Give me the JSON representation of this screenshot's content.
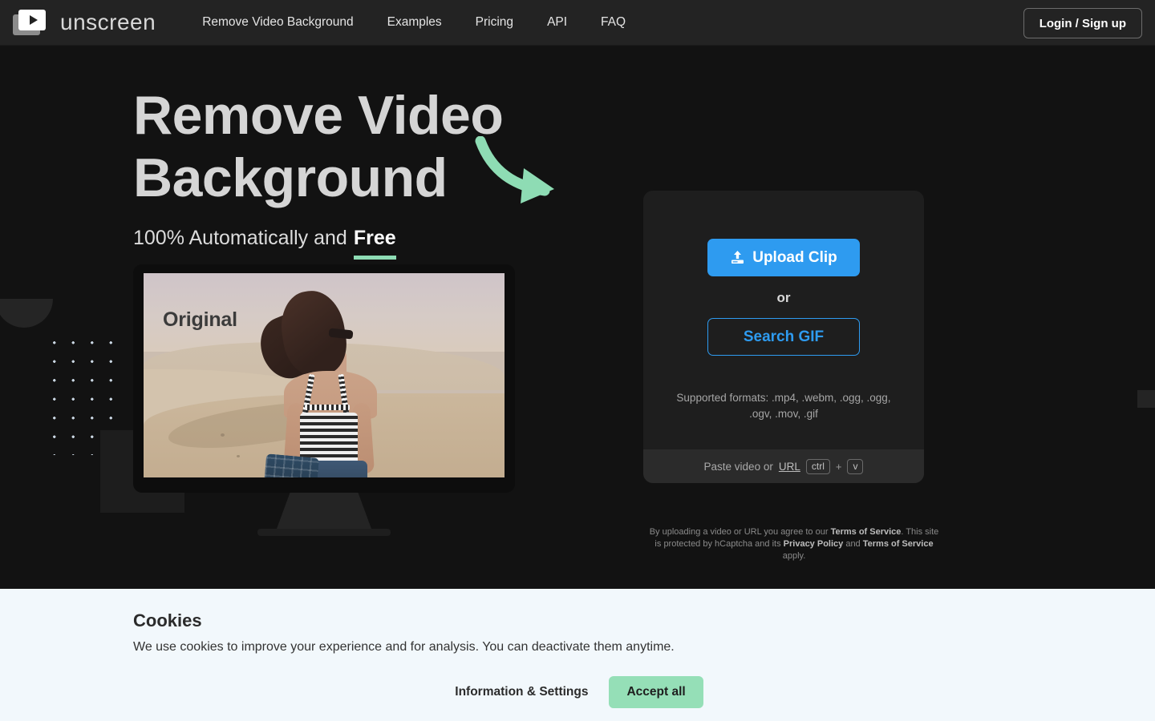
{
  "header": {
    "logo_text": "unscreen",
    "logo_icon": "video-play-cards-icon",
    "nav": [
      {
        "label": "Remove Video Background"
      },
      {
        "label": "Examples"
      },
      {
        "label": "Pricing"
      },
      {
        "label": "API"
      },
      {
        "label": "FAQ"
      }
    ],
    "login_label": "Login / Sign up",
    "bg_color": "#232323"
  },
  "hero": {
    "title": "Remove Video Background",
    "subtitle_prefix": "100% Automatically and",
    "subtitle_highlight": "Free",
    "highlight_underline_color": "#8edcb4",
    "arrow_icon": "curved-arrow-icon",
    "arrow_color": "#8edcb4"
  },
  "preview": {
    "label": "Original",
    "alt": "woman in striped top standing in desert dunes"
  },
  "upload": {
    "upload_label": "Upload Clip",
    "upload_icon": "upload-icon",
    "upload_color": "#2e9bf0",
    "or_label": "or",
    "gif_label": "Search GIF",
    "formats": "Supported formats: .mp4, .webm, .ogg, .ogg, .ogv, .mov, .gif",
    "paste_prefix": "Paste video or",
    "paste_link": "URL",
    "key_ctrl": "ctrl",
    "key_plus": "+",
    "key_v": "v"
  },
  "legal": {
    "line1_a": "By uploading a video or URL you agree to our ",
    "tos": "Terms of Service",
    "line1_b": ". This site is",
    "line2_a": "protected by hCaptcha and its ",
    "privacy": "Privacy Policy",
    "line2_b": " and ",
    "tos2": "Terms of Service",
    "line2_c": " apply."
  },
  "cookies": {
    "title": "Cookies",
    "text": "We use cookies to improve your experience and for analysis. You can deactivate them anytime.",
    "info_label": "Information & Settings",
    "accept_label": "Accept all",
    "accept_color": "#95dfb7",
    "bg_color": "#f2f8fc"
  }
}
